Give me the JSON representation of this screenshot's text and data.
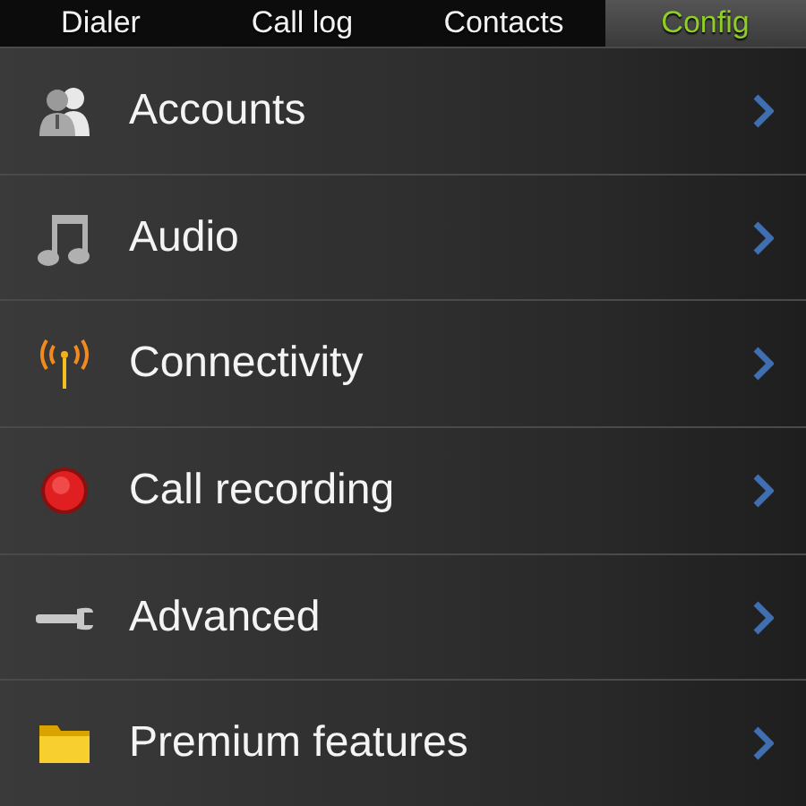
{
  "tabs": [
    {
      "label": "Dialer",
      "selected": false
    },
    {
      "label": "Call log",
      "selected": false
    },
    {
      "label": "Contacts",
      "selected": false
    },
    {
      "label": "Config",
      "selected": true
    }
  ],
  "settings": [
    {
      "label": "Accounts"
    },
    {
      "label": "Audio"
    },
    {
      "label": "Connectivity"
    },
    {
      "label": "Call recording"
    },
    {
      "label": "Advanced"
    },
    {
      "label": "Premium features"
    }
  ]
}
